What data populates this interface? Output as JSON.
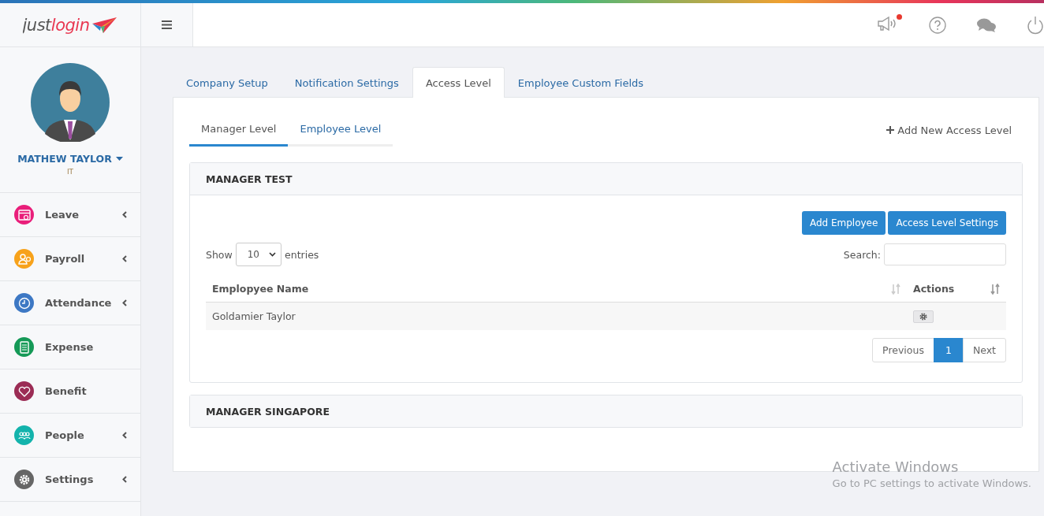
{
  "logo": {
    "text": "justlogin"
  },
  "user": {
    "name": "MATHEW TAYLOR",
    "department": "IT"
  },
  "sidebar": {
    "items": [
      {
        "label": "Leave",
        "color": "#e91e7a",
        "kind": "calendar",
        "has_submenu": true
      },
      {
        "label": "Payroll",
        "color": "#f7a21b",
        "kind": "payroll",
        "has_submenu": true
      },
      {
        "label": "Attendance",
        "color": "#3d78c4",
        "kind": "clock",
        "has_submenu": true
      },
      {
        "label": "Expense",
        "color": "#159957",
        "kind": "document",
        "has_submenu": false
      },
      {
        "label": "Benefit",
        "color": "#9b2c55",
        "kind": "heart",
        "has_submenu": false
      },
      {
        "label": "People",
        "color": "#13b3ac",
        "kind": "people",
        "has_submenu": true
      },
      {
        "label": "Settings",
        "color": "#666666",
        "kind": "gear",
        "has_submenu": true
      }
    ]
  },
  "header": {
    "notification_unread": true
  },
  "tabs": [
    {
      "label": "Company Setup",
      "selected": false
    },
    {
      "label": "Notification Settings",
      "selected": false
    },
    {
      "label": "Access Level",
      "selected": true
    },
    {
      "label": "Employee Custom Fields",
      "selected": false
    }
  ],
  "subtabs": [
    {
      "label": "Manager Level",
      "selected": true
    },
    {
      "label": "Employee Level",
      "selected": false
    }
  ],
  "add_level_link": "Add New Access Level",
  "panels": [
    {
      "title": "MANAGER TEST",
      "expanded": true,
      "buttons": [
        "Add Employee",
        "Access Level Settings"
      ],
      "show_label": "Show",
      "page_size": "10",
      "entries_label": "entries",
      "search_label": "Search:",
      "columns": [
        "Emplopyee Name",
        "Actions"
      ],
      "rows": [
        {
          "name": "Goldamier Taylor"
        }
      ],
      "pagination": [
        {
          "label": "Previous",
          "selected": false
        },
        {
          "label": "1",
          "selected": true
        },
        {
          "label": "Next",
          "selected": false
        }
      ]
    },
    {
      "title": "MANAGER SINGAPORE",
      "expanded": false
    }
  ],
  "os_overlay": {
    "title": "Activate Windows",
    "subtitle": "Go to PC settings to activate Windows."
  }
}
